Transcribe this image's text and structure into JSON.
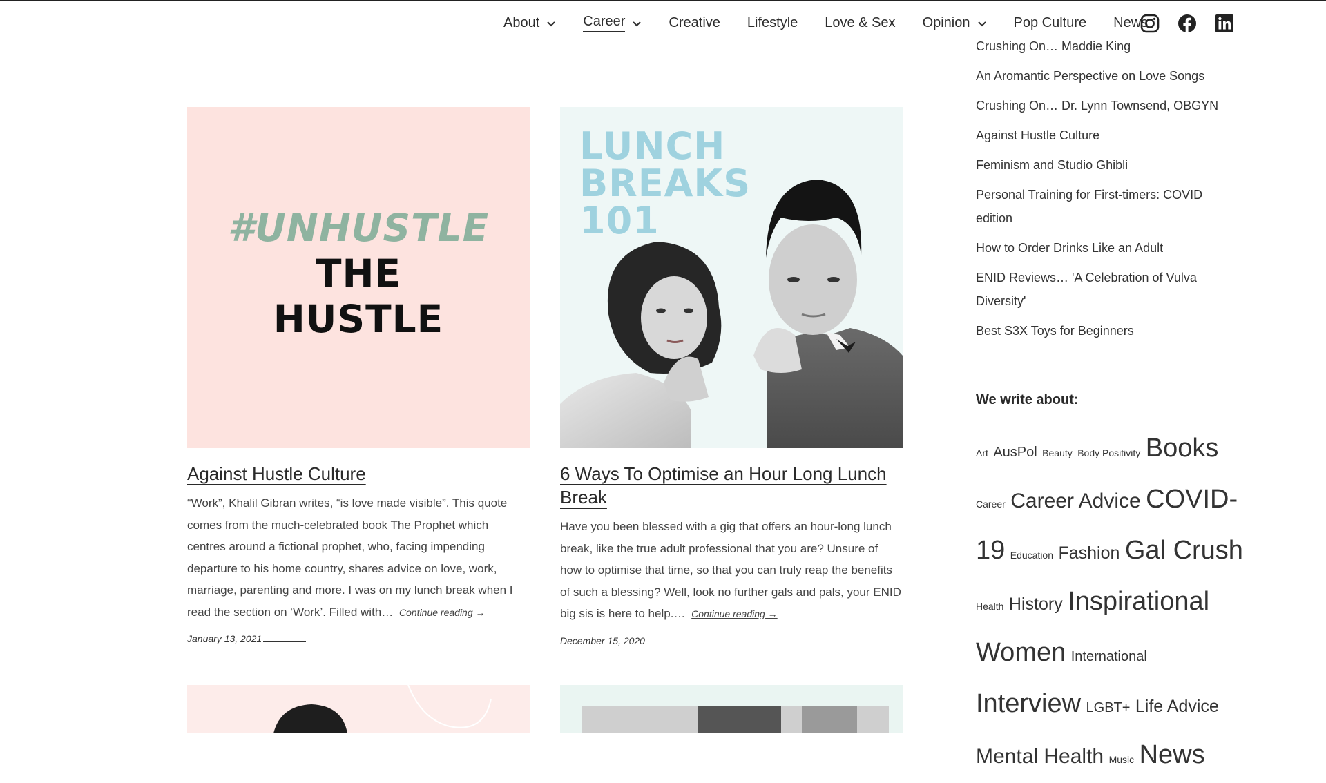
{
  "nav": {
    "items": [
      {
        "label": "About",
        "dropdown": true,
        "active": false
      },
      {
        "label": "Career",
        "dropdown": true,
        "active": true
      },
      {
        "label": "Creative",
        "dropdown": false,
        "active": false
      },
      {
        "label": "Lifestyle",
        "dropdown": false,
        "active": false
      },
      {
        "label": "Love & Sex",
        "dropdown": false,
        "active": false
      },
      {
        "label": "Opinion",
        "dropdown": true,
        "active": false
      },
      {
        "label": "Pop Culture",
        "dropdown": false,
        "active": false
      },
      {
        "label": "News",
        "dropdown": false,
        "active": false
      }
    ],
    "social_icons": [
      "instagram-icon",
      "facebook-icon",
      "linkedin-icon"
    ]
  },
  "posts": [
    {
      "image_text": [
        "#UNHUSTLE",
        "THE",
        "HUSTLE"
      ],
      "title": "Against Hustle Culture",
      "excerpt": "“Work”, Khalil Gibran writes, “is love made visible”.  This quote comes from the much-celebrated book The Prophet which centres around a fictional prophet, who, facing impending departure to his home country, shares advice on love, work, marriage, parenting and more.  I was on my lunch break when I read the section on ‘Work’. Filled with…",
      "more": "Continue reading →",
      "date": "January 13, 2021"
    },
    {
      "image_text": [
        "LUNCH",
        "BREAKS",
        "101"
      ],
      "title": "6 Ways To Optimise an Hour Long Lunch Break",
      "excerpt": "Have you been blessed with a gig that offers an hour-long lunch break, like the true adult professional that you are? Unsure of how to optimise that time, so that you can truly reap the benefits of such a blessing? Well, look no further gals and pals, your ENID big sis is here to help.…",
      "more": "Continue reading →",
      "date": "December 15, 2020"
    }
  ],
  "sidebar": {
    "recent_posts": [
      "Crushing On… Maddie King",
      "An Aromantic Perspective on Love Songs",
      "Crushing On… Dr. Lynn Townsend, OBGYN",
      "Against Hustle Culture",
      "Feminism and Studio Ghibli",
      "Personal Training for First-timers: COVID edition",
      "How to Order Drinks Like an Adult",
      "ENID Reviews… 'A Celebration of Vulva Diversity'",
      "Best S3X Toys for Beginners"
    ],
    "heading": "We write about:",
    "tags": [
      {
        "label": "Art",
        "size": 1
      },
      {
        "label": "AusPol",
        "size": 2
      },
      {
        "label": "Beauty",
        "size": 1
      },
      {
        "label": "Body Positivity",
        "size": 1
      },
      {
        "label": "Books",
        "size": 5
      },
      {
        "label": "Career",
        "size": 1
      },
      {
        "label": "Career Advice",
        "size": 4
      },
      {
        "label": "COVID-19",
        "size": 5
      },
      {
        "label": "Education",
        "size": 1
      },
      {
        "label": "Fashion",
        "size": 3
      },
      {
        "label": "Gal Crush",
        "size": 5
      },
      {
        "label": "Health",
        "size": 1
      },
      {
        "label": "History",
        "size": 3
      },
      {
        "label": "Inspirational Women",
        "size": 5
      },
      {
        "label": "International",
        "size": 2
      },
      {
        "label": "Interview",
        "size": 5
      },
      {
        "label": "LGBT+",
        "size": 2
      },
      {
        "label": "Life Advice",
        "size": 3
      },
      {
        "label": "Mental Health",
        "size": 4
      },
      {
        "label": "Music",
        "size": 1
      },
      {
        "label": "News",
        "size": 5
      }
    ]
  }
}
